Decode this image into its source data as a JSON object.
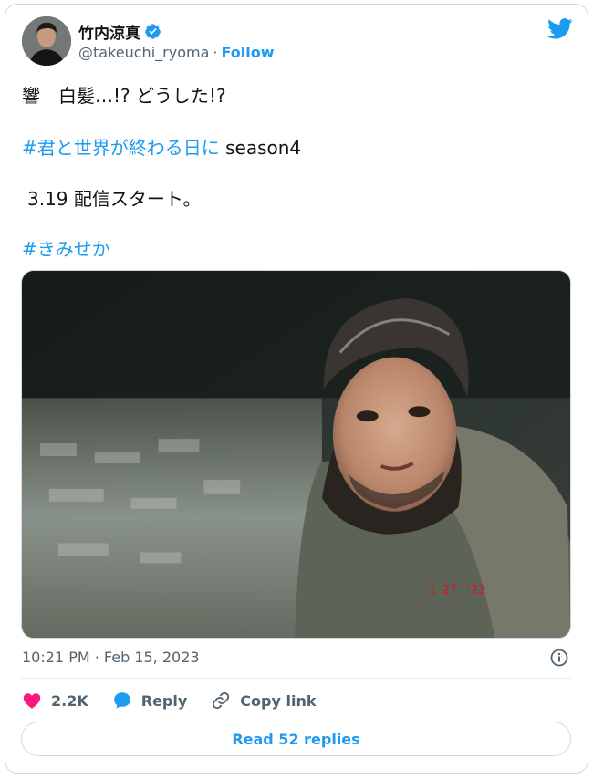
{
  "author": {
    "display_name": "竹内涼真",
    "handle": "@takeuchi_ryoma",
    "separator": "·",
    "follow_label": "Follow"
  },
  "tweet": {
    "line1": "響　白髪…!? どうした!?",
    "hashtag1": "#君と世界が終わる日に",
    "line2_suffix": " season4",
    "line3": "3.19 配信スタート。",
    "hashtag2": "#きみせか"
  },
  "photo": {
    "date_stamp": "1 27 '23"
  },
  "meta": {
    "timestamp": "10:21 PM · Feb 15, 2023"
  },
  "actions": {
    "like_count": "2.2K",
    "reply_label": "Reply",
    "copy_label": "Copy link"
  },
  "footer": {
    "read_replies_label": "Read 52 replies"
  },
  "colors": {
    "accent": "#1d9bf0",
    "like": "#f91880",
    "muted": "#536471"
  },
  "icons": [
    "verified-badge-icon",
    "twitter-bird-icon",
    "info-icon",
    "heart-icon",
    "reply-bubble-icon",
    "link-icon"
  ]
}
